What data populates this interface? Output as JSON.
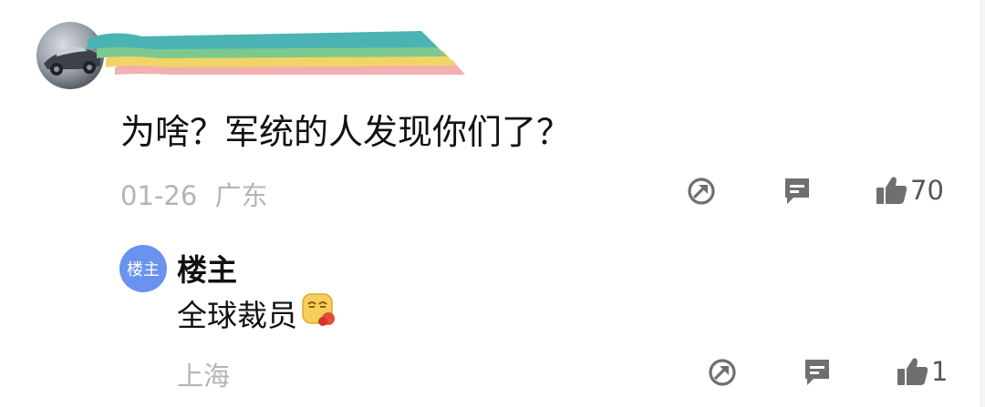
{
  "comment": {
    "avatar_icon": "car-avatar-icon",
    "text": "为啥？军统的人发现你们了？",
    "date": "01-26",
    "location": "广东",
    "like_count": "70",
    "banner_colors": [
      "#4bb3b3",
      "#7cc98f",
      "#f0d565",
      "#f2b0b0"
    ]
  },
  "reply": {
    "avatar_label": "楼主",
    "author": "楼主",
    "text": "全球裁员",
    "emoji_icon": "cry-laugh-emoji-icon",
    "location": "上海",
    "like_count": "1"
  },
  "colors": {
    "text": "#111111",
    "meta": "#b4b4b4",
    "icon": "#6f6f6f",
    "op_badge": "#6a92ef"
  }
}
